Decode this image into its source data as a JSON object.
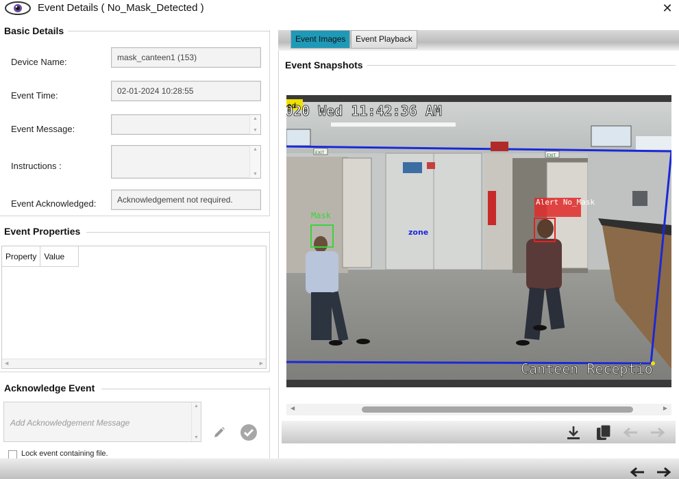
{
  "window": {
    "title": "Event Details ( No_Mask_Detected )",
    "close_glyph": "✕"
  },
  "basic_details": {
    "title": "Basic Details",
    "device_name_label": "Device Name:",
    "device_name_value": "mask_canteen1 (153)",
    "event_time_label": "Event Time:",
    "event_time_value": "02-01-2024 10:28:55",
    "event_message_label": "Event Message:",
    "event_message_value": "",
    "instructions_label": "Instructions :",
    "instructions_value": "",
    "event_ack_label": "Event Acknowledged:",
    "event_ack_value": "Acknowledgement not required."
  },
  "event_properties": {
    "title": "Event Properties",
    "columns": [
      "Property",
      "Value"
    ]
  },
  "acknowledge": {
    "title": "Acknowledge Event",
    "placeholder": "Add Acknowledgement Message",
    "lock_label": "Lock event containing file.",
    "lock_checked": false
  },
  "tabs": [
    {
      "label": "Event Images",
      "active": true
    },
    {
      "label": "Event Playback",
      "active": false
    }
  ],
  "snapshots": {
    "title": "Event Snapshots",
    "overlay_timestamp": "020 Wed 11:42:36 AM",
    "overlay_location": "Canteen Receptio",
    "overlay_tag": "ed",
    "zone_label": "zone",
    "box_mask_label": "Mask",
    "box_alert_label": "Alert No_Mask",
    "exit_sign_1": "EXIT",
    "exit_sign_2": "EXIT",
    "colors": {
      "mask_box": "#39d43b",
      "alert_box": "#e52222",
      "zone_line": "#1a28d8"
    }
  },
  "toolbar_icons": [
    "download-icon",
    "copy-icon",
    "arrow-left-icon",
    "arrow-right-icon"
  ],
  "footer_icons": [
    "arrow-left-icon",
    "arrow-right-icon"
  ],
  "colors": {
    "active_tab": "#1e9ab8"
  }
}
